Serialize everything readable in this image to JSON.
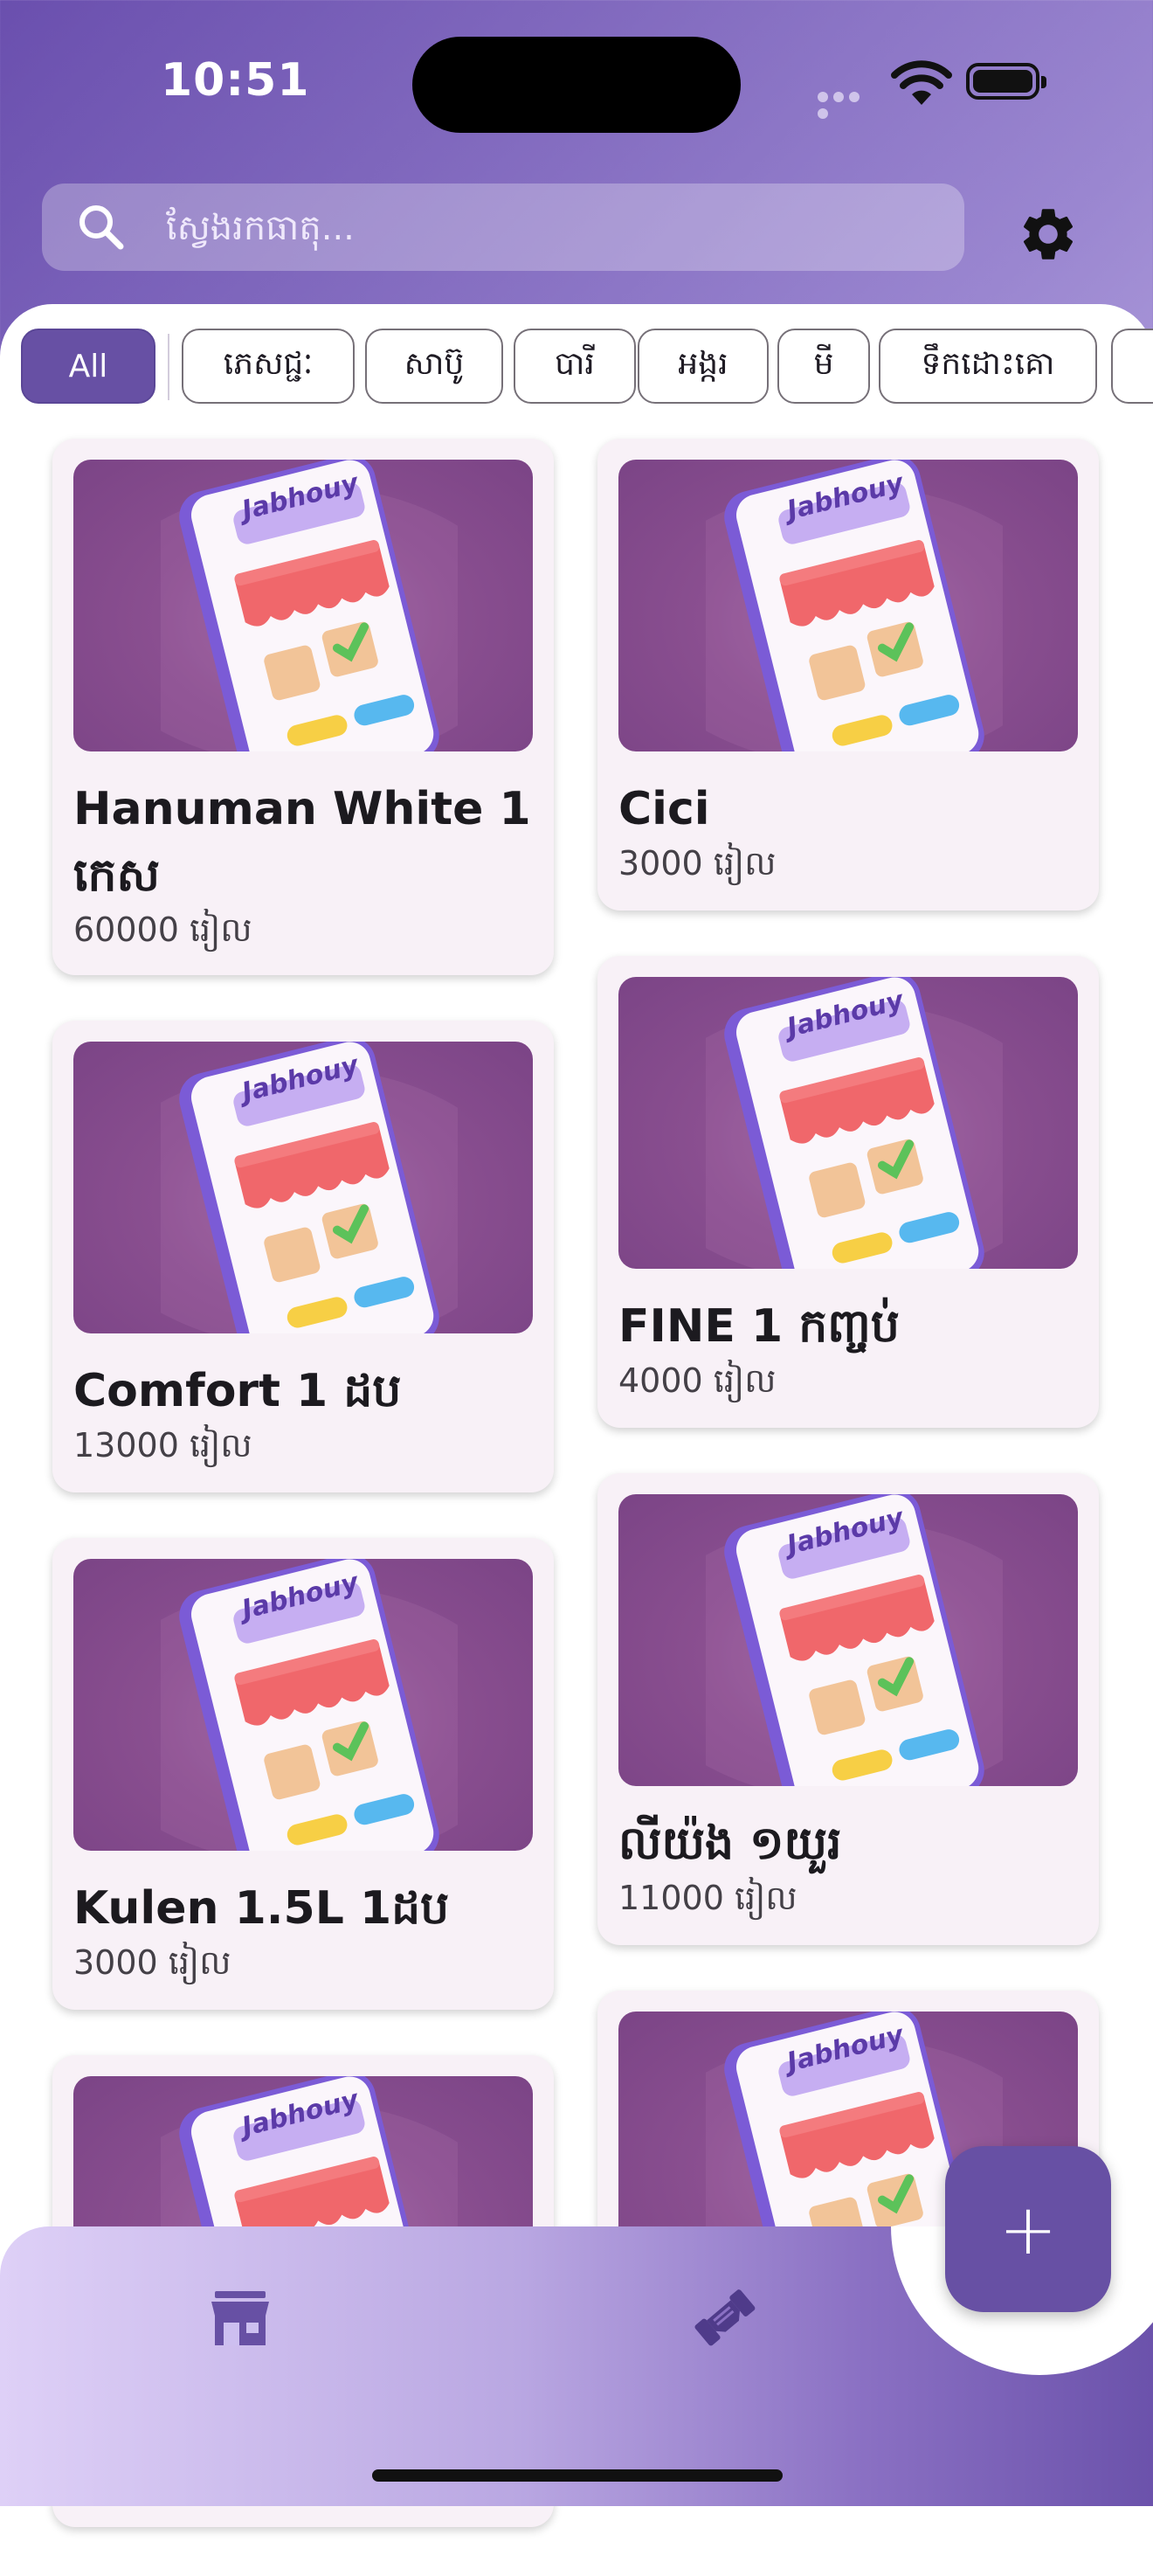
{
  "status_bar": {
    "time": "10:51"
  },
  "search": {
    "placeholder": "ស្វែងរកធាតុ..."
  },
  "chips": [
    "All",
    "ភេសជ្ជៈ",
    "សាប៊ូ",
    "បារី",
    "អង្ករ",
    "មី",
    "ទឹកដោះគោ"
  ],
  "active_chip": "All",
  "products": [
    {
      "name": "Hanuman White 1 កេស",
      "price": "60000 រៀល",
      "image_text": "Jabhouy"
    },
    {
      "name": "Cici",
      "price": "3000 រៀល",
      "image_text": "Jabhouy"
    },
    {
      "name": "Comfort 1 ដប",
      "price": "13000 រៀល",
      "image_text": "Jabhouy"
    },
    {
      "name": "FINE 1 កញ្ចប់",
      "price": "4000 រៀល",
      "image_text": "Jabhouy"
    },
    {
      "name": "Kulen 1.5L 1ដប",
      "price": "3000 រៀល",
      "image_text": "Jabhouy"
    },
    {
      "name": "លីយ៉ង ១យួរ",
      "price": "11000 រៀល",
      "image_text": "Jabhouy"
    }
  ],
  "fab": {
    "label": "+"
  },
  "icons": {
    "search": "search-icon",
    "settings": "gear-icon",
    "store": "store-icon",
    "deal": "handshake-icon"
  },
  "colors": {
    "accent": "#6750a4",
    "card_bg": "#f8f1f7",
    "image_bg": "#8a4f90"
  }
}
